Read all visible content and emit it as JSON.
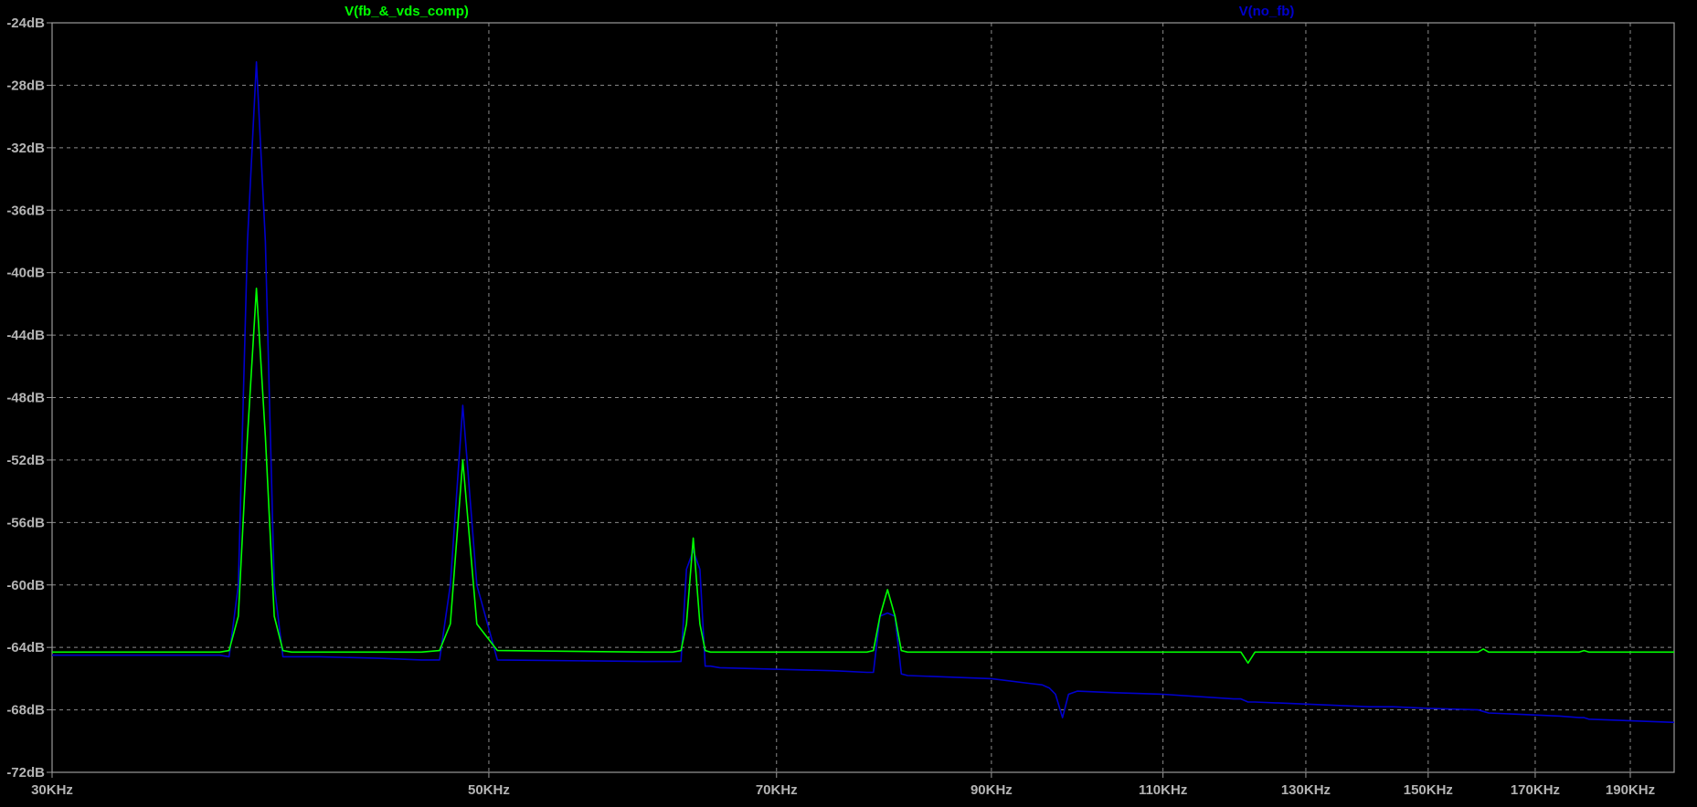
{
  "chart_data": {
    "type": "line",
    "title": "",
    "xlabel": "",
    "ylabel": "",
    "x_scale": "log",
    "xlim": [
      30000,
      200000
    ],
    "ylim": [
      -72,
      -24
    ],
    "x_tick_values": [
      30000,
      50000,
      70000,
      90000,
      110000,
      130000,
      150000,
      170000,
      190000
    ],
    "x_tick_labels": [
      "30KHz",
      "50KHz",
      "70KHz",
      "90KHz",
      "110KHz",
      "130KHz",
      "150KHz",
      "170KHz",
      "190KHz"
    ],
    "y_tick_values": [
      -24,
      -28,
      -32,
      -36,
      -40,
      -44,
      -48,
      -52,
      -56,
      -60,
      -64,
      -68,
      -72
    ],
    "y_tick_labels": [
      "-24dB",
      "-28dB",
      "-32dB",
      "-36dB",
      "-40dB",
      "-44dB",
      "-48dB",
      "-52dB",
      "-56dB",
      "-60dB",
      "-64dB",
      "-68dB",
      "-72dB"
    ],
    "grid": true,
    "legend_position": "top",
    "series": [
      {
        "name": "V(fb_&_vds_comp)",
        "color": "#00ff00",
        "x": [
          30000,
          36500,
          36900,
          37300,
          37700,
          38100,
          38500,
          38900,
          39300,
          39700,
          40000,
          41000,
          44000,
          46200,
          47200,
          47800,
          48500,
          49300,
          50500,
          60000,
          62000,
          62600,
          63000,
          63500,
          64000,
          64400,
          64800,
          65500,
          75000,
          77800,
          78400,
          79000,
          79700,
          80400,
          81000,
          81600,
          90000,
          94000,
          95500,
          96300,
          97000,
          97800,
          98500,
          99500,
          104000,
          110000,
          119500,
          120500,
          121500,
          122500,
          140000,
          144000,
          150000,
          159000,
          160000,
          161000,
          175000,
          179000,
          180000,
          181000,
          200000
        ],
        "y": [
          -64.3,
          -64.3,
          -64.2,
          -62.0,
          -50.5,
          -41.0,
          -50.5,
          -62.0,
          -64.2,
          -64.3,
          -64.3,
          -64.3,
          -64.3,
          -64.3,
          -64.2,
          -62.5,
          -52.0,
          -62.5,
          -64.2,
          -64.3,
          -64.3,
          -64.2,
          -62.5,
          -57.0,
          -62.5,
          -64.2,
          -64.3,
          -64.3,
          -64.3,
          -64.3,
          -64.2,
          -62.0,
          -60.3,
          -62.0,
          -64.2,
          -64.3,
          -64.3,
          -64.3,
          -64.3,
          -64.3,
          -64.3,
          -64.3,
          -64.3,
          -64.3,
          -64.3,
          -64.3,
          -64.3,
          -64.3,
          -65.0,
          -64.3,
          -64.3,
          -64.3,
          -64.3,
          -64.3,
          -64.1,
          -64.3,
          -64.3,
          -64.3,
          -64.2,
          -64.3,
          -64.3
        ]
      },
      {
        "name": "V(no_fb)",
        "color": "#0000cc",
        "x": [
          30000,
          36500,
          36900,
          37300,
          37700,
          38100,
          38500,
          38900,
          39300,
          39700,
          40000,
          41000,
          44000,
          46200,
          47200,
          47800,
          48500,
          49300,
          50500,
          60000,
          62000,
          62600,
          63000,
          63500,
          64000,
          64400,
          64800,
          65500,
          75000,
          77800,
          78400,
          79000,
          79700,
          80400,
          81000,
          81600,
          90000,
          94000,
          95500,
          96300,
          97000,
          97800,
          98500,
          99500,
          104000,
          110000,
          119500,
          120500,
          121500,
          122500,
          140000,
          144000,
          150000,
          159000,
          160000,
          161000,
          175000,
          179000,
          180000,
          181000,
          200000
        ],
        "y": [
          -64.5,
          -64.5,
          -64.6,
          -60.0,
          -38.0,
          -26.5,
          -38.0,
          -60.0,
          -64.6,
          -64.6,
          -64.6,
          -64.6,
          -64.7,
          -64.8,
          -64.8,
          -60.0,
          -48.5,
          -60.0,
          -64.8,
          -64.9,
          -64.9,
          -64.9,
          -59.0,
          -57.8,
          -59.0,
          -65.2,
          -65.2,
          -65.3,
          -65.5,
          -65.6,
          -65.6,
          -62.0,
          -61.8,
          -62.0,
          -65.7,
          -65.8,
          -66.0,
          -66.3,
          -66.4,
          -66.6,
          -67.0,
          -68.5,
          -67.0,
          -66.8,
          -66.9,
          -67.0,
          -67.3,
          -67.3,
          -67.5,
          -67.5,
          -67.8,
          -67.8,
          -67.9,
          -68.0,
          -68.1,
          -68.2,
          -68.4,
          -68.5,
          -68.5,
          -68.6,
          -68.8
        ]
      }
    ]
  }
}
